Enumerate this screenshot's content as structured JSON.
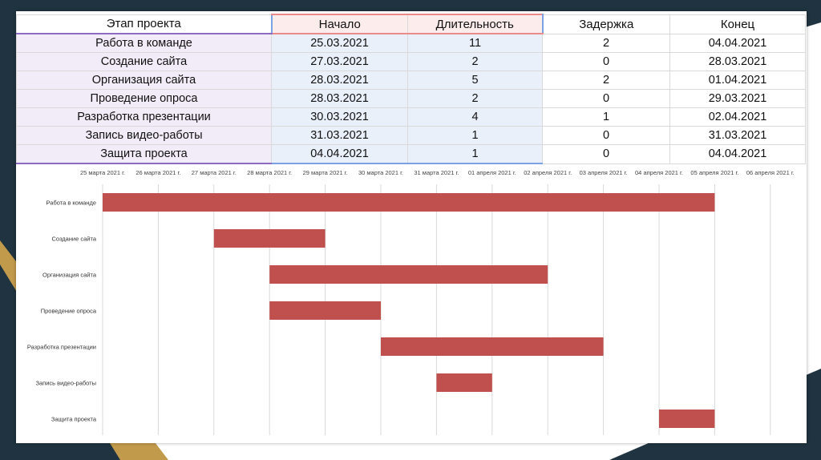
{
  "table": {
    "headers": [
      "Этап проекта",
      "Начало",
      "Длительность",
      "Задержка",
      "Конец"
    ],
    "rows": [
      [
        "Работа в команде",
        "25.03.2021",
        "11",
        "2",
        "04.04.2021"
      ],
      [
        "Создание сайта",
        "27.03.2021",
        "2",
        "0",
        "28.03.2021"
      ],
      [
        "Организация сайта",
        "28.03.2021",
        "5",
        "2",
        "01.04.2021"
      ],
      [
        "Проведение опроса",
        "28.03.2021",
        "2",
        "0",
        "29.03.2021"
      ],
      [
        "Разработка презентации",
        "30.03.2021",
        "4",
        "1",
        "02.04.2021"
      ],
      [
        "Запись видео-работы",
        "31.03.2021",
        "1",
        "0",
        "31.03.2021"
      ],
      [
        "Защита проекта",
        "04.04.2021",
        "1",
        "0",
        "04.04.2021"
      ]
    ]
  },
  "chart_data": {
    "type": "bar",
    "orientation": "horizontal-gantt",
    "title": "",
    "xlabel": "",
    "ylabel": "",
    "x_tick_labels": [
      "25 марта 2021 г.",
      "26 марта 2021 г.",
      "27 марта 2021 г.",
      "28 марта 2021 г.",
      "29 марта 2021 г.",
      "30 марта 2021 г.",
      "31 марта 2021 г.",
      "01 апреля 2021 г.",
      "02 апреля 2021 г.",
      "03 апреля 2021 г.",
      "04 апреля 2021 г.",
      "05 апреля 2021 г.",
      "06 апреля 2021 г."
    ],
    "xlim": [
      "2021-03-25",
      "2021-04-06"
    ],
    "grid": true,
    "legend": "none",
    "bar_color": "#c0504d",
    "categories": [
      "Работа в команде",
      "Создание сайта",
      "Организация сайта",
      "Проведение опроса",
      "Разработка презентации",
      "Запись видео-работы",
      "Защита проекта"
    ],
    "tasks": [
      {
        "name": "Работа в команде",
        "start": "2021-03-25",
        "end": "2021-04-05"
      },
      {
        "name": "Создание сайта",
        "start": "2021-03-27",
        "end": "2021-03-29"
      },
      {
        "name": "Организация сайта",
        "start": "2021-03-28",
        "end": "2021-04-02"
      },
      {
        "name": "Проведение опроса",
        "start": "2021-03-28",
        "end": "2021-03-30"
      },
      {
        "name": "Разработка презентации",
        "start": "2021-03-30",
        "end": "2021-04-03"
      },
      {
        "name": "Запись видео-работы",
        "start": "2021-03-31",
        "end": "2021-04-01"
      },
      {
        "name": "Защита проекта",
        "start": "2021-04-04",
        "end": "2021-04-05"
      }
    ]
  }
}
